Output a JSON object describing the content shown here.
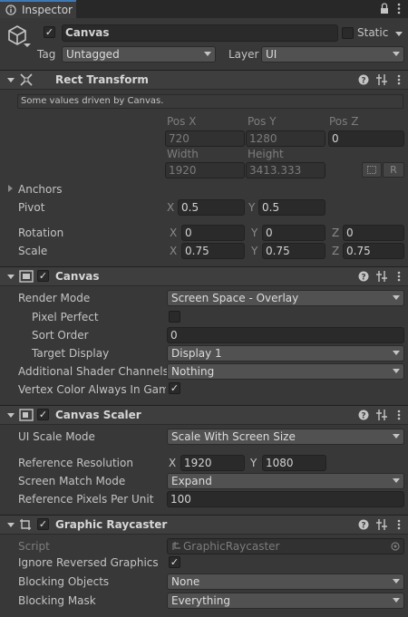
{
  "tab": {
    "title": "Inspector"
  },
  "object": {
    "name": "Canvas",
    "static_label": "Static",
    "tag_label": "Tag",
    "tag_value": "Untagged",
    "layer_label": "Layer",
    "layer_value": "UI"
  },
  "rect_transform": {
    "title": "Rect Transform",
    "note": "Some values driven by Canvas.",
    "pos_x_label": "Pos X",
    "pos_y_label": "Pos Y",
    "pos_z_label": "Pos Z",
    "pos_x": "720",
    "pos_y": "1280",
    "pos_z": "0",
    "width_label": "Width",
    "height_label": "Height",
    "width": "1920",
    "height": "3413.333",
    "r_button": "R",
    "anchors_label": "Anchors",
    "pivot_label": "Pivot",
    "pivot_x": "0.5",
    "pivot_y": "0.5",
    "rotation_label": "Rotation",
    "rot_x": "0",
    "rot_y": "0",
    "rot_z": "0",
    "scale_label": "Scale",
    "scale_x": "0.75",
    "scale_y": "0.75",
    "scale_z": "0.75",
    "x": "X",
    "y": "Y",
    "z": "Z"
  },
  "canvas": {
    "title": "Canvas",
    "render_mode_label": "Render Mode",
    "render_mode": "Screen Space - Overlay",
    "pixel_perfect_label": "Pixel Perfect",
    "sort_order_label": "Sort Order",
    "sort_order": "0",
    "target_display_label": "Target Display",
    "target_display": "Display 1",
    "shader_channels_label": "Additional Shader Channels",
    "shader_channels": "Nothing",
    "vertex_color_label": "Vertex Color Always In Gamm"
  },
  "canvas_scaler": {
    "title": "Canvas Scaler",
    "ui_scale_mode_label": "UI Scale Mode",
    "ui_scale_mode": "Scale With Screen Size",
    "ref_res_label": "Reference Resolution",
    "ref_x": "1920",
    "ref_y": "1080",
    "match_mode_label": "Screen Match Mode",
    "match_mode": "Expand",
    "ref_ppu_label": "Reference Pixels Per Unit",
    "ref_ppu": "100"
  },
  "raycaster": {
    "title": "Graphic Raycaster",
    "script_label": "Script",
    "script_value": "GraphicRaycaster",
    "ignore_reversed_label": "Ignore Reversed Graphics",
    "blocking_objects_label": "Blocking Objects",
    "blocking_objects": "None",
    "blocking_mask_label": "Blocking Mask",
    "blocking_mask": "Everything"
  },
  "colors": {
    "tab_accent": "#3a79bb",
    "panel_bg": "#383838",
    "header_bg": "#3e3e3e"
  }
}
